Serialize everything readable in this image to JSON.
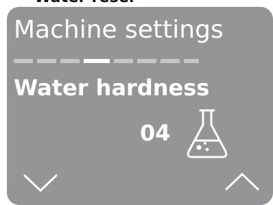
{
  "top_partial_text": "Water reser",
  "screen": {
    "title": "Machine settings",
    "subtitle": "Water hardness",
    "value": "04"
  },
  "progress": {
    "total_segments": 8,
    "active_index": 3
  },
  "icons": {
    "flask": "flask-icon",
    "down": "chevron-down-icon",
    "up": "chevron-up-icon"
  },
  "colors": {
    "panel": "#949597",
    "text": "#ffffff",
    "segment_inactive": "#c4c5c7",
    "segment_active": "#ffffff"
  }
}
